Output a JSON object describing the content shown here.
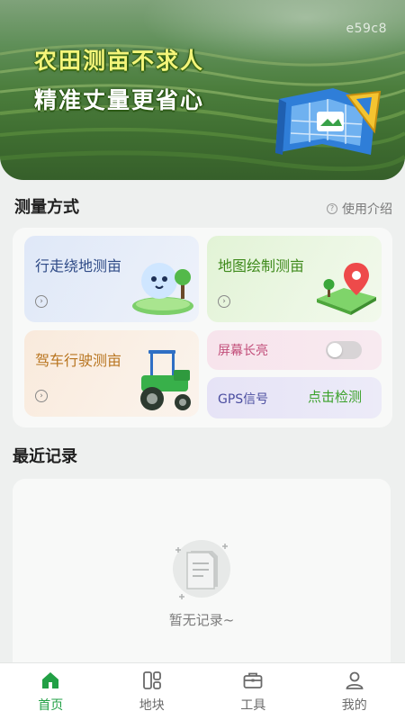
{
  "banner": {
    "slogan_line1": "农田测亩不求人",
    "slogan_line2": "精准丈量更省心",
    "watermark": "e59c8"
  },
  "measure_section": {
    "title": "测量方式",
    "help_link": "使用介绍",
    "cards": {
      "walk": "行走绕地测亩",
      "map": "地图绘制测亩",
      "drive": "驾车行驶测亩",
      "screen_on": "屏幕长亮",
      "gps": "GPS信号",
      "gps_action": "点击检测"
    },
    "screen_on_toggle": "off"
  },
  "recent_section": {
    "title": "最近记录",
    "empty_text": "暂无记录~"
  },
  "bottom_nav": {
    "items": [
      {
        "label": "首页",
        "icon": "home-icon",
        "active": true
      },
      {
        "label": "地块",
        "icon": "plots-icon",
        "active": false
      },
      {
        "label": "工具",
        "icon": "toolbox-icon",
        "active": false
      },
      {
        "label": "我的",
        "icon": "profile-icon",
        "active": false
      }
    ]
  },
  "colors": {
    "accent": "#22a045",
    "walk_label": "#2e4a86",
    "map_label": "#3f8a1c",
    "drive_label": "#b8741e",
    "screen_label": "#c24e7a",
    "gps_label": "#4b4ea0"
  }
}
